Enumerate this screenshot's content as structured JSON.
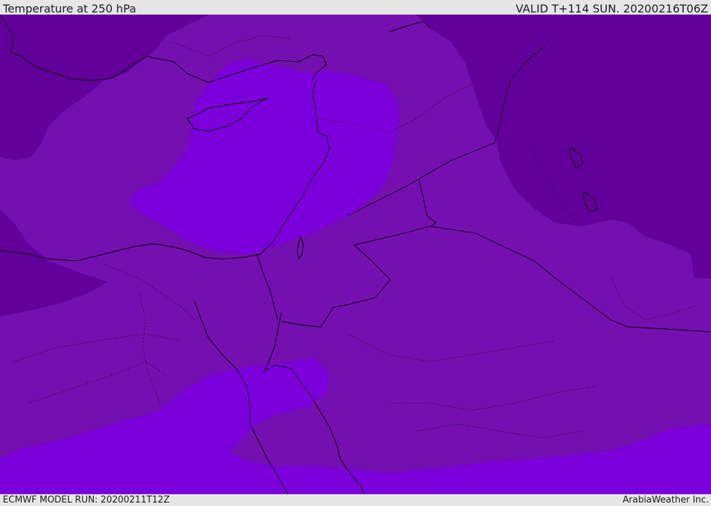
{
  "header": {
    "title": "Temperature at 250 hPa",
    "valid": "VALID T+114 SUN. 20200216T06Z"
  },
  "footer": {
    "model_run": "ECMWF MODEL RUN: 20200211T12Z",
    "credit": "ArabiaWeather Inc."
  },
  "map": {
    "colors": {
      "band_mid": "#7510b0",
      "band_cold": "#62009a",
      "band_warm": "#7c00db",
      "coastline": "#000000"
    }
  }
}
